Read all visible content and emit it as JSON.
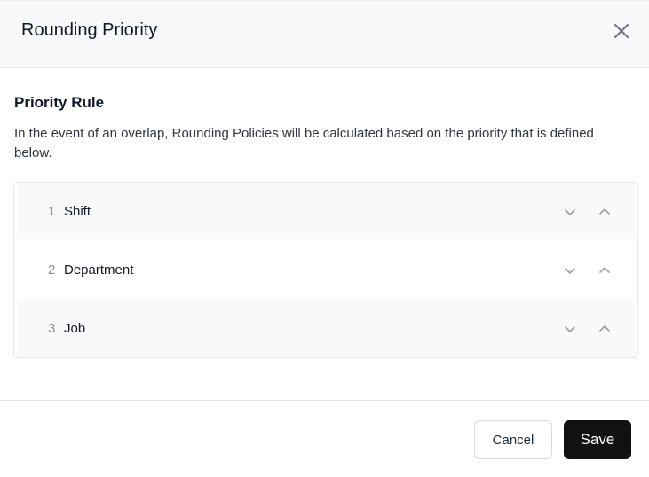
{
  "dialog": {
    "title": "Rounding Priority",
    "close_icon": "close-icon"
  },
  "section": {
    "title": "Priority Rule",
    "description": "In the event of an overlap, Rounding Policies will be calculated based on the priority that is defined below."
  },
  "priority_items": [
    {
      "number": "1",
      "label": "Shift"
    },
    {
      "number": "2",
      "label": "Department"
    },
    {
      "number": "3",
      "label": "Job"
    }
  ],
  "icons": {
    "move_down": "chevron-down-icon",
    "move_up": "chevron-up-icon"
  },
  "footer": {
    "cancel_label": "Cancel",
    "save_label": "Save"
  },
  "colors": {
    "header_bg": "#f8f9fb",
    "row_shaded_bg": "#f8f9fb",
    "primary_button": "#111111",
    "muted_text": "#8a9099"
  }
}
